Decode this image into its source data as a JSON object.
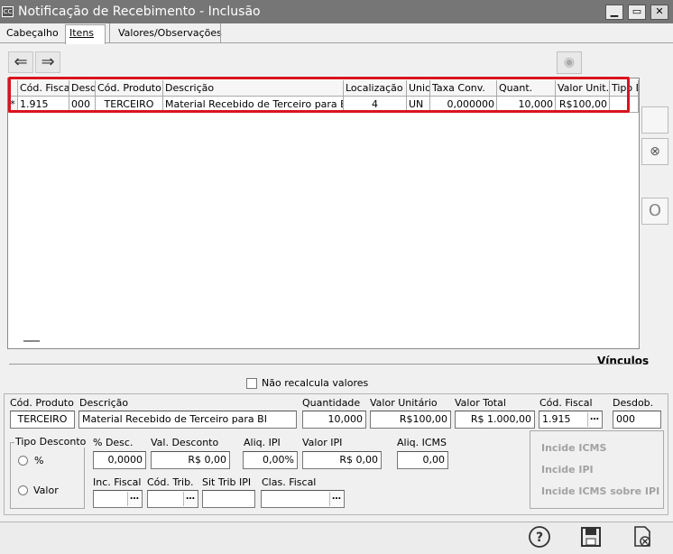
{
  "window": {
    "icon_text": "CC",
    "title": "Notificação de Recebimento - Inclusão"
  },
  "tabs": [
    {
      "label": "Cabeçalho"
    },
    {
      "label": "Itens"
    },
    {
      "label": "Valores/Observações"
    }
  ],
  "grid": {
    "columns": [
      "Cód. Fiscal",
      "Desdo",
      "Cód. Produto",
      "Descrição",
      "Localização",
      "Unid",
      "Taxa Conv.",
      "Quant.",
      "Valor Unit.",
      "Tipo D"
    ],
    "row_marker": "*",
    "row": [
      "1.915",
      "000",
      "TERCEIRO",
      "Material Recebido de Terceiro para BI",
      "4",
      "UN",
      "0,000000",
      "10,000",
      "R$100,00",
      ""
    ]
  },
  "vinculos_label": "Vínculos",
  "recalc": {
    "label": "Não recalcula valores",
    "checked": false
  },
  "form": {
    "cod_produto": {
      "label": "Cód. Produto",
      "value": "TERCEIRO"
    },
    "descricao": {
      "label": "Descrição",
      "value": "Material Recebido de Terceiro para BI"
    },
    "quantidade": {
      "label": "Quantidade",
      "value": "10,000"
    },
    "valor_unitario": {
      "label": "Valor Unitário",
      "value": "R$100,00"
    },
    "valor_total": {
      "label": "Valor Total",
      "value": "R$ 1.000,00"
    },
    "cod_fiscal": {
      "label": "Cód. Fiscal",
      "value": "1.915"
    },
    "desdob": {
      "label": "Desdob.",
      "value": "000"
    },
    "tipo_desconto": {
      "label": "Tipo Desconto",
      "opt_pct": "%",
      "opt_valor": "Valor"
    },
    "pct_desc": {
      "label": "% Desc.",
      "value": "0,0000"
    },
    "val_desconto": {
      "label": "Val. Desconto",
      "value": "R$ 0,00"
    },
    "aliq_ipi": {
      "label": "Aliq. IPI",
      "value": "0,00%"
    },
    "valor_ipi": {
      "label": "Valor IPI",
      "value": "R$ 0,00"
    },
    "aliq_icms": {
      "label": "Aliq. ICMS",
      "value": "0,00"
    },
    "inc_fiscal": {
      "label": "Inc. Fiscal",
      "value": ""
    },
    "cod_trib": {
      "label": "Cód. Trib.",
      "value": ""
    },
    "sit_trib_ipi": {
      "label": "Sit Trib IPI",
      "value": ""
    },
    "clas_fiscal": {
      "label": "Clas. Fiscal",
      "value": ""
    },
    "incide_icms": "Incide ICMS",
    "incide_ipi": "Incide IPI",
    "incide_icms_ipi": "Incide ICMS sobre IPI"
  },
  "icons": {
    "back": "arrow-left-icon",
    "forward": "arrow-right-icon",
    "view": "eye-icon",
    "help": "help-icon",
    "save": "save-icon",
    "cancel": "cancel-document-icon"
  }
}
